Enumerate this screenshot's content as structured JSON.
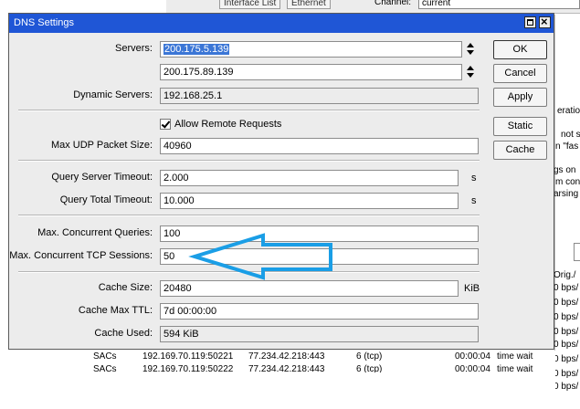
{
  "background": {
    "tabs": [
      "Interface List",
      "Ethernet"
    ],
    "channel_label": "Channel:",
    "channel_value": "current",
    "right_fragments": [
      "eration",
      "not s",
      "n \"fas",
      "gs on",
      "m con",
      "arsing",
      "Orig./",
      "0 bps/",
      "0 bps/",
      "0 bps/",
      "0 bps/",
      "0 bps/",
      "0 bps/",
      "0 bps/",
      "0 bps/"
    ],
    "connections": [
      {
        "proto": "SACs",
        "src": "192.169.70.119:50221",
        "dst": "77.234.42.218:443",
        "type": "6 (tcp)",
        "time": "00:00:04",
        "state": "time wait"
      },
      {
        "proto": "SACs",
        "src": "192.169.70.119:50222",
        "dst": "77.234.42.218:443",
        "type": "6 (tcp)",
        "time": "00:00:04",
        "state": "time wait"
      }
    ]
  },
  "dialog": {
    "title": "DNS Settings",
    "fields": {
      "servers_label": "Servers:",
      "server1": "200.175.5.139",
      "server2": "200.175.89.139",
      "dynamic_servers_label": "Dynamic Servers:",
      "dynamic_servers": "192.168.25.1",
      "allow_remote_label": "Allow Remote Requests",
      "max_udp_label": "Max UDP Packet Size:",
      "max_udp": "40960",
      "query_server_timeout_label": "Query Server Timeout:",
      "query_server_timeout": "2.000",
      "query_total_timeout_label": "Query Total Timeout:",
      "query_total_timeout": "10.000",
      "max_concurrent_queries_label": "Max. Concurrent Queries:",
      "max_concurrent_queries": "100",
      "max_tcp_sessions_label": "Max. Concurrent TCP Sessions:",
      "max_tcp_sessions": "50",
      "cache_size_label": "Cache Size:",
      "cache_size": "20480",
      "cache_max_ttl_label": "Cache Max TTL:",
      "cache_max_ttl": "7d 00:00:00",
      "cache_used_label": "Cache Used:",
      "cache_used": "594 KiB",
      "unit_s": "s",
      "unit_kib": "KiB"
    },
    "buttons": {
      "ok": "OK",
      "cancel": "Cancel",
      "apply": "Apply",
      "static": "Static",
      "cache": "Cache"
    }
  },
  "colors": {
    "titlebar": "#1f56d6",
    "arrow": "#1a9ee6",
    "selection": "#3b76d6"
  }
}
